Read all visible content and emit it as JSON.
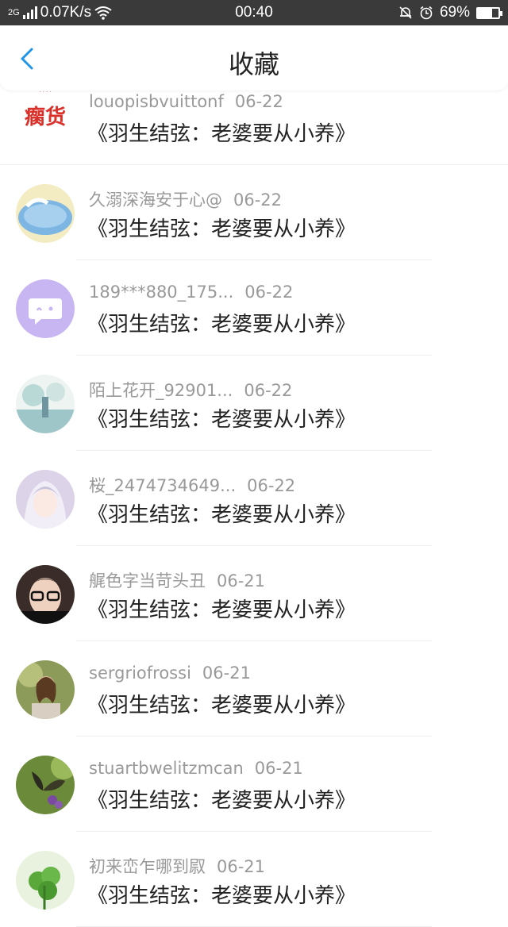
{
  "status_bar": {
    "network": "2G",
    "speed": "0.07K/s",
    "time": "00:40",
    "battery": "69%",
    "battery_fraction": 0.69
  },
  "header": {
    "title": "收藏",
    "back_icon": "chevron-left-icon",
    "accent_color": "#2196e8"
  },
  "items": [
    {
      "user": "louopisbvuittonf",
      "date": "06-22",
      "title": "《羽生结弦：老婆要从小养》",
      "avatar_text": "瘸货"
    },
    {
      "user": "久溺深海安于心@",
      "date": "06-22",
      "title": "《羽生结弦：老婆要从小养》"
    },
    {
      "user": "189***880_175...",
      "date": "06-22",
      "title": "《羽生结弦：老婆要从小养》"
    },
    {
      "user": "陌上花开_92901...",
      "date": "06-22",
      "title": "《羽生结弦：老婆要从小养》"
    },
    {
      "user": "桜_2474734649...",
      "date": "06-22",
      "title": "《羽生结弦：老婆要从小养》"
    },
    {
      "user": "艉色字当苛头丑",
      "date": "06-21",
      "title": "《羽生结弦：老婆要从小养》"
    },
    {
      "user": "sergriofrossi",
      "date": "06-21",
      "title": "《羽生结弦：老婆要从小养》"
    },
    {
      "user": "stuartbwelitzmcan",
      "date": "06-21",
      "title": "《羽生结弦：老婆要从小养》"
    },
    {
      "user": "初来峦乍哪到叞",
      "date": "06-21",
      "title": "《羽生结弦：老婆要从小养》"
    }
  ]
}
